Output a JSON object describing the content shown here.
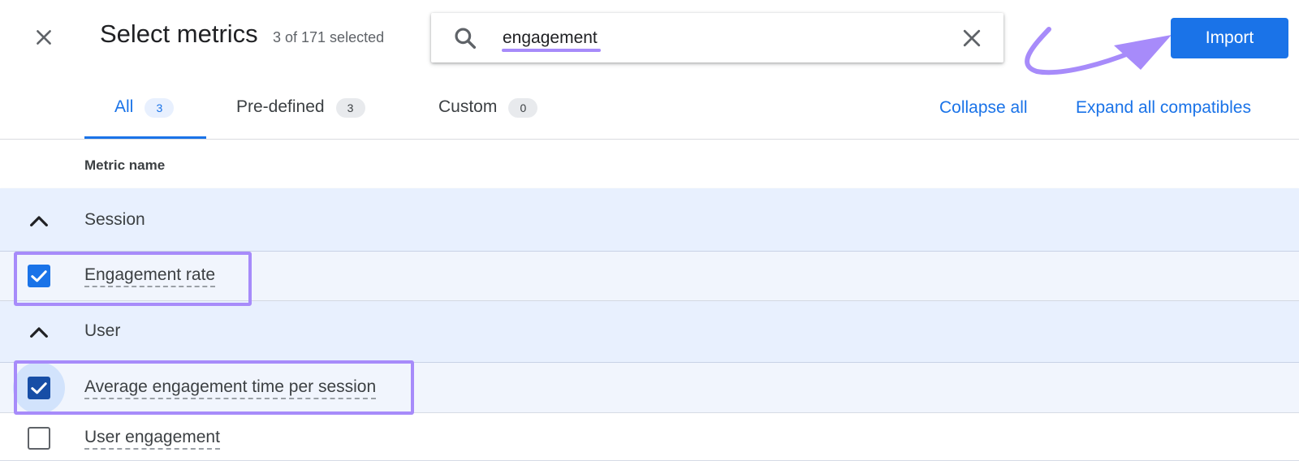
{
  "header": {
    "title": "Select metrics",
    "subtitle": "3 of 171 selected",
    "search": {
      "value": "engagement",
      "placeholder": ""
    },
    "import_label": "Import"
  },
  "tabs": [
    {
      "label": "All",
      "count": "3",
      "active": true
    },
    {
      "label": "Pre-defined",
      "count": "3",
      "active": false
    },
    {
      "label": "Custom",
      "count": "0",
      "active": false
    }
  ],
  "actions": {
    "collapse_all": "Collapse all",
    "expand_all": "Expand all compatibles"
  },
  "table": {
    "column_header": "Metric name",
    "groups": [
      {
        "name": "Session",
        "expanded": true,
        "items": [
          {
            "label": "Engagement rate",
            "checked": true
          }
        ]
      },
      {
        "name": "User",
        "expanded": true,
        "items": [
          {
            "label": "Average engagement time per session",
            "checked": true
          },
          {
            "label": "User engagement",
            "checked": false
          }
        ]
      }
    ]
  },
  "colors": {
    "primary": "#1a73e8",
    "annotation": "#a78bfa",
    "group_row_bg": "#e8f0fe"
  },
  "icons": {
    "close": "close-icon",
    "search": "search-icon",
    "clear": "clear-icon",
    "collapse": "chevron-up-icon",
    "check": "check-icon"
  }
}
